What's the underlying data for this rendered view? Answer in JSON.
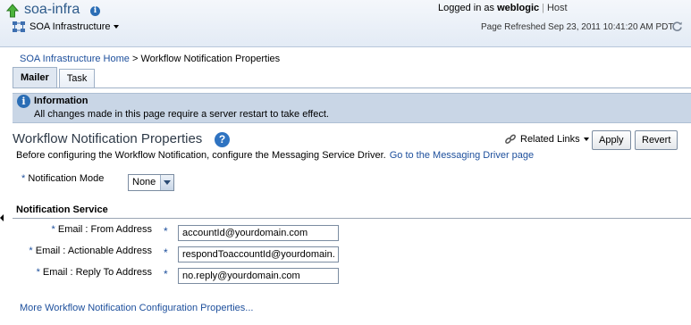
{
  "header": {
    "app_title": "soa-infra",
    "target_menu": "SOA Infrastructure",
    "logged_in_prefix": "Logged in as",
    "username": "weblogic",
    "host_label": "Host",
    "page_refreshed": "Page Refreshed Sep 23, 2011 10:41:20 AM PDT"
  },
  "breadcrumb": {
    "home": "SOA Infrastructure Home",
    "separator": ">",
    "current": "Workflow Notification Properties"
  },
  "tabs": [
    {
      "label": "Mailer",
      "active": true
    },
    {
      "label": "Task",
      "active": false
    }
  ],
  "info_banner": {
    "title": "Information",
    "message": "All changes made in this page require a server restart to take effect."
  },
  "page": {
    "title": "Workflow Notification Properties",
    "related_links": "Related Links",
    "apply": "Apply",
    "revert": "Revert",
    "description": "Before configuring the Workflow Notification, configure the Messaging Service Driver.",
    "driver_link": "Go to the Messaging Driver page"
  },
  "form": {
    "required_marker": "*",
    "notification_mode_label": "Notification Mode",
    "notification_mode_value": "None",
    "section_title": "Notification Service",
    "fields": [
      {
        "label": "Email : From Address",
        "value": "accountId@yourdomain.com"
      },
      {
        "label": "Email : Actionable Address",
        "value": "respondToaccountId@yourdomain."
      },
      {
        "label": "Email : Reply To Address",
        "value": "no.reply@yourdomain.com"
      }
    ],
    "more_link": "More Workflow Notification Configuration Properties..."
  },
  "colors": {
    "link": "#1d4f9c",
    "banner": "#c9d6e6",
    "header_bg": "#e3ebf5"
  }
}
